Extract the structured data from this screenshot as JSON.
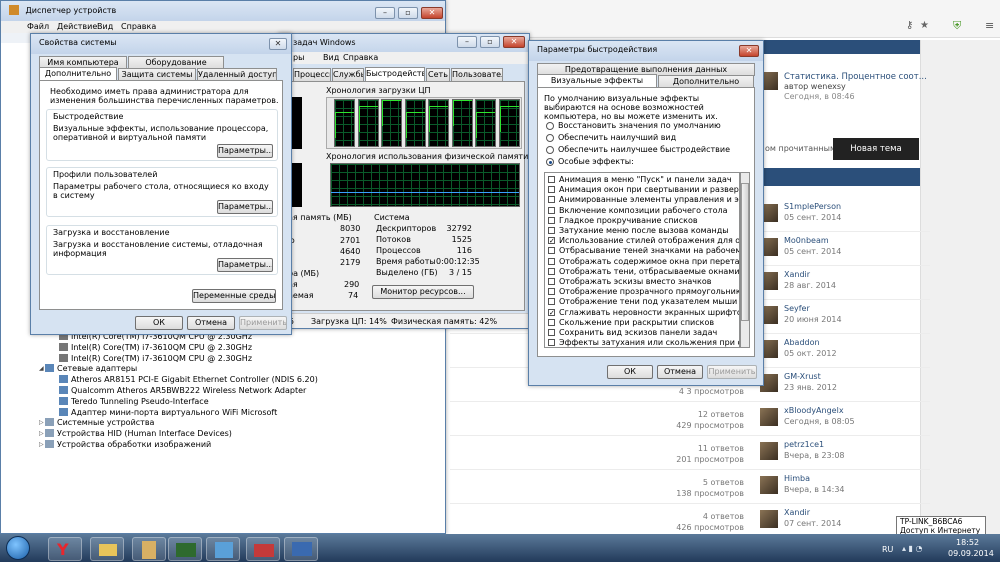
{
  "browser": {
    "tab_strip_color": "#2b4f7a",
    "nav_right_icons": [
      "star-icon",
      "shield-icon",
      "menu-icon"
    ]
  },
  "forum": {
    "top_item": {
      "title": "Статистика. Процентное соот...",
      "author": "автор wenexsy",
      "time": "Сегодня, в 08:46"
    },
    "filter_label": "ом прочитанным",
    "new_topic_button": "Новая тема",
    "rows": [
      {
        "answers": "",
        "views": "",
        "user": "S1mplePerson",
        "date": "05 сент. 2014"
      },
      {
        "answers": "",
        "views": "",
        "user": "Mo0nbeam",
        "date": "05 сент. 2014"
      },
      {
        "answers": "",
        "views": "",
        "user": "Xandir",
        "date": "28 авг. 2014"
      },
      {
        "answers": "",
        "views": "",
        "user": "Seyfer",
        "date": "20 июня 2014"
      },
      {
        "answers": "",
        "views": "",
        "user": "Abaddon",
        "date": "05 окт. 2012"
      },
      {
        "answers": "",
        "views": "4 3 просмотров",
        "user": "GM-Xrust",
        "date": "23 янв. 2012"
      },
      {
        "answers": "12 ответов",
        "views": "429 просмотров",
        "user": "xBloodyAngelx",
        "date": "Сегодня, в 08:05"
      },
      {
        "answers": "11 ответов",
        "views": "201 просмотров",
        "user": "petrz1ce1",
        "date": "Вчера, в 23:08"
      },
      {
        "answers": "5 ответов",
        "views": "138 просмотров",
        "user": "Himba",
        "date": "Вчера, в 14:34"
      },
      {
        "answers": "4 ответов",
        "views": "426 просмотров",
        "user": "Xandir",
        "date": "07 сент. 2014"
      }
    ]
  },
  "devmgr": {
    "title": "Диспетчер устройств",
    "menu": [
      "Файл",
      "Действие",
      "Вид",
      "Справка"
    ],
    "tree": [
      {
        "label": "Intel(R) Core(TM) i7-3610QM CPU @ 2.30GHz",
        "indent": 1,
        "icon": "cpu-icon"
      },
      {
        "label": "Intel(R) Core(TM) i7-3610QM CPU @ 2.30GHz",
        "indent": 1,
        "icon": "cpu-icon"
      },
      {
        "label": "Intel(R) Core(TM) i7-3610QM CPU @ 2.30GHz",
        "indent": 1,
        "icon": "cpu-icon"
      },
      {
        "label": "Сетевые адаптеры",
        "indent": 0,
        "icon": "network-icon",
        "expander": "◢"
      },
      {
        "label": "Atheros AR8151 PCI-E Gigabit Ethernet Controller (NDIS 6.20)",
        "indent": 1,
        "icon": "network-icon"
      },
      {
        "label": "Qualcomm Atheros AR5BWB222 Wireless Network Adapter",
        "indent": 1,
        "icon": "network-icon"
      },
      {
        "label": "Teredo Tunneling Pseudo-Interface",
        "indent": 1,
        "icon": "network-icon"
      },
      {
        "label": "Адаптер мини-порта виртуального WiFi Microsoft",
        "indent": 1,
        "icon": "network-icon"
      },
      {
        "label": "Системные устройства",
        "indent": 0,
        "icon": "folder-icon",
        "expander": "▷"
      },
      {
        "label": "Устройства HID (Human Interface Devices)",
        "indent": 0,
        "icon": "hid-icon",
        "expander": "▷"
      },
      {
        "label": "Устройства обработки изображений",
        "indent": 0,
        "icon": "camera-icon",
        "expander": "▷"
      }
    ]
  },
  "taskmgr": {
    "title": "задач Windows",
    "menu": [
      "ры",
      "Вид",
      "Справка"
    ],
    "tabs": [
      "Процессы",
      "Службы",
      "Быстродействие",
      "Сеть",
      "Пользователи"
    ],
    "active_tab": "Быстродействие",
    "cpu_history_label": "Хронология загрузки ЦП",
    "mem_history_label": "Хронология использования физической памяти",
    "phys_mem_label": "ая память (МБ)",
    "phys_mem_values": [
      "8030",
      "2701",
      "4640",
      "2179"
    ],
    "phys_mem_keys": [
      "",
      "ю",
      "",
      ""
    ],
    "kernel_label": "ра (МБ)",
    "kernel_keys": [
      "ая",
      "аемая"
    ],
    "kernel_values": [
      "290",
      "74"
    ],
    "system_label": "Система",
    "system_rows": [
      {
        "k": "Дескрипторов",
        "v": "32792"
      },
      {
        "k": "Потоков",
        "v": "1525"
      },
      {
        "k": "Процессов",
        "v": "116"
      },
      {
        "k": "Время работы",
        "v": "0:00:12:35"
      },
      {
        "k": "Выделено (ГБ)",
        "v": "3 / 15"
      }
    ],
    "resmon_button": "Монитор ресурсов...",
    "status_left": "5",
    "status_cpu": "Загрузка ЦП: 14%",
    "status_mem": "Физическая память: 42%"
  },
  "sysprops": {
    "title": "Свойства системы",
    "tabs_row1": [
      "Имя компьютера",
      "Оборудование"
    ],
    "tabs_row2": [
      "Дополнительно",
      "Защита системы",
      "Удаленный доступ"
    ],
    "active_tab": "Дополнительно",
    "intro": "Необходимо иметь права администратора для изменения большинства перечисленных параметров.",
    "groups": [
      {
        "title": "Быстродействие",
        "text": "Визуальные эффекты, использование процессора, оперативной и виртуальной памяти",
        "button": "Параметры..."
      },
      {
        "title": "Профили пользователей",
        "text": "Параметры рабочего стола, относящиеся ко входу в систему",
        "button": "Параметры..."
      },
      {
        "title": "Загрузка и восстановление",
        "text": "Загрузка и восстановление системы, отладочная информация",
        "button": "Параметры..."
      }
    ],
    "env_button": "Переменные среды...",
    "ok": "ОК",
    "cancel": "Отмена",
    "apply": "Применить"
  },
  "perfopts": {
    "title": "Параметры быстродействия",
    "tabs_row1": [
      "Предотвращение выполнения данных"
    ],
    "tabs_row2": [
      "Визуальные эффекты",
      "Дополнительно"
    ],
    "active_tab": "Визуальные эффекты",
    "intro": "По умолчанию визуальные эффекты выбираются на основе возможностей компьютера, но вы можете изменить их.",
    "radios": [
      {
        "label": "Восстановить значения по умолчанию",
        "checked": false
      },
      {
        "label": "Обеспечить наилучший вид",
        "checked": false
      },
      {
        "label": "Обеспечить наилучшее быстродействие",
        "checked": false
      },
      {
        "label": "Особые эффекты:",
        "checked": true
      }
    ],
    "effects": [
      {
        "label": "Анимация в меню \"Пуск\" и панели задач",
        "checked": false
      },
      {
        "label": "Анимация окон при свертывании и развертывании",
        "checked": false
      },
      {
        "label": "Анимированные элементы управления и элементы вну",
        "checked": false
      },
      {
        "label": "Включение композиции рабочего стола",
        "checked": false
      },
      {
        "label": "Гладкое прокручивание списков",
        "checked": false
      },
      {
        "label": "Затухание меню после вызова команды",
        "checked": false
      },
      {
        "label": "Использование стилей отображения для окон и кнопок",
        "checked": true
      },
      {
        "label": "Отбрасывание теней значками на рабочем столе",
        "checked": false
      },
      {
        "label": "Отображать содержимое окна при перетаскивании",
        "checked": false
      },
      {
        "label": "Отображать тени, отбрасываемые окнами",
        "checked": false
      },
      {
        "label": "Отображать эскизы вместо значков",
        "checked": false
      },
      {
        "label": "Отображение прозрачного прямоугольника выделени",
        "checked": false
      },
      {
        "label": "Отображение тени под указателем мыши",
        "checked": false
      },
      {
        "label": "Сглаживать неровности экранных шрифтов",
        "checked": true
      },
      {
        "label": "Скольжение при раскрытии списков",
        "checked": false
      },
      {
        "label": "Сохранить вид эскизов панели задач",
        "checked": false
      },
      {
        "label": "Эффекты затухания или скольжения при обращении к",
        "checked": false
      }
    ],
    "ok": "ОК",
    "cancel": "Отмена",
    "apply": "Применить"
  },
  "tray": {
    "tooltip_line1": "TP-LINK_B6BCA6",
    "tooltip_line2": "Доступ к Интернету",
    "lang": "RU",
    "time": "18:52",
    "date": "09.09.2014"
  },
  "taskbar_apps": [
    "start-orb-icon",
    "yandex-browser-icon",
    "explorer-icon",
    "media-player-icon",
    "terminal-icon",
    "network-icon",
    "toolbox-icon",
    "monitor-icon"
  ]
}
